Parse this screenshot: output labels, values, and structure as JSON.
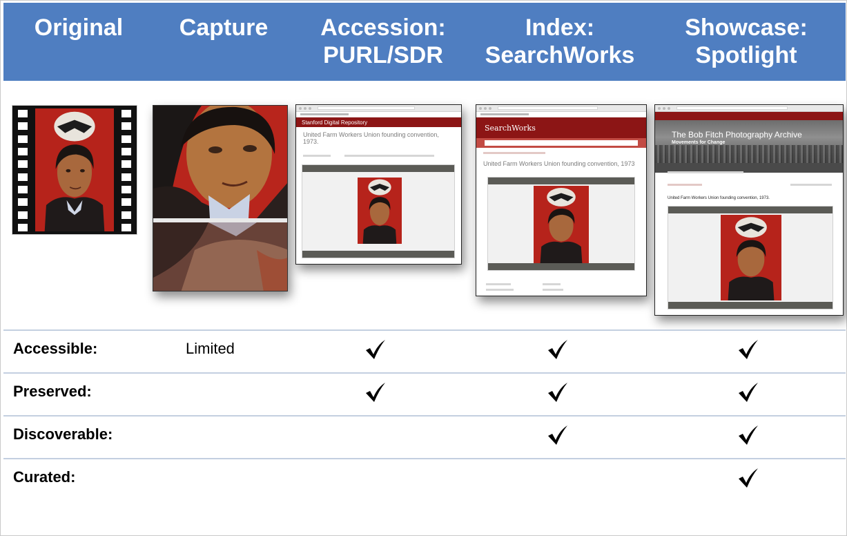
{
  "header": {
    "columns": [
      {
        "line1": "Original",
        "line2": ""
      },
      {
        "line1": "Capture",
        "line2": ""
      },
      {
        "line1": "Accession:",
        "line2": "PURL/SDR"
      },
      {
        "line1": "Index:",
        "line2": "SearchWorks"
      },
      {
        "line1": "Showcase:",
        "line2": "Spotlight"
      }
    ]
  },
  "thumbnails": {
    "purl": {
      "bar_title": "Stanford Digital Repository",
      "item_title": "United Farm Workers Union founding convention, 1973."
    },
    "searchworks": {
      "brand": "SearchWorks",
      "item_title": "United Farm Workers Union founding convention, 1973"
    },
    "spotlight": {
      "hero_title": "The Bob Fitch Photography Archive",
      "hero_subtitle": "Movements for Change",
      "item_title": "United Farm Workers Union founding convention, 1973."
    }
  },
  "rows": [
    {
      "label": "Accessible:",
      "capture": "Limited",
      "accession": true,
      "index": true,
      "showcase": true
    },
    {
      "label": "Preserved:",
      "capture": "",
      "accession": true,
      "index": true,
      "showcase": true
    },
    {
      "label": "Discoverable:",
      "capture": "",
      "accession": false,
      "index": true,
      "showcase": true
    },
    {
      "label": "Curated:",
      "capture": "",
      "accession": false,
      "index": false,
      "showcase": true
    }
  ],
  "colors": {
    "header_bg": "#4f7ec1",
    "header_text": "#ffffff",
    "row_divider": "#c3cfe0",
    "stanford_red": "#8c1515"
  },
  "icons": {
    "check": "checkmark-icon",
    "film": "film-strip-icon"
  }
}
